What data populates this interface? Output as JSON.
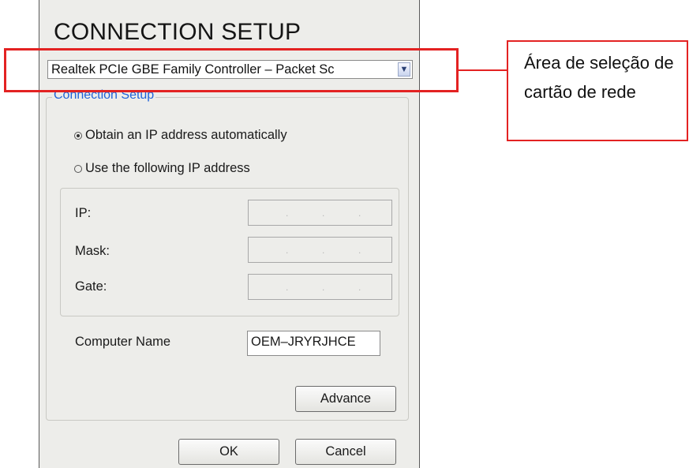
{
  "window": {
    "title": "CONNECTION SETUP"
  },
  "nic_select": {
    "value": "Realtek PCIe GBE Family Controller – Packet Sc"
  },
  "connection_group": {
    "label": "Connection Setup",
    "radio_auto_label": "Obtain an IP address automatically",
    "radio_manual_label": "Use the following IP address",
    "selected": "auto"
  },
  "ip_settings": {
    "ip_label": "IP:",
    "mask_label": "Mask:",
    "gate_label": "Gate:"
  },
  "computer_name": {
    "label": "Computer Name",
    "value": "OEM–JRYRJHCE"
  },
  "buttons": {
    "advance": "Advance",
    "ok": "OK",
    "cancel": "Cancel"
  },
  "annotation": {
    "text": "Área de seleção de cartão de rede",
    "color": "#e32222"
  }
}
